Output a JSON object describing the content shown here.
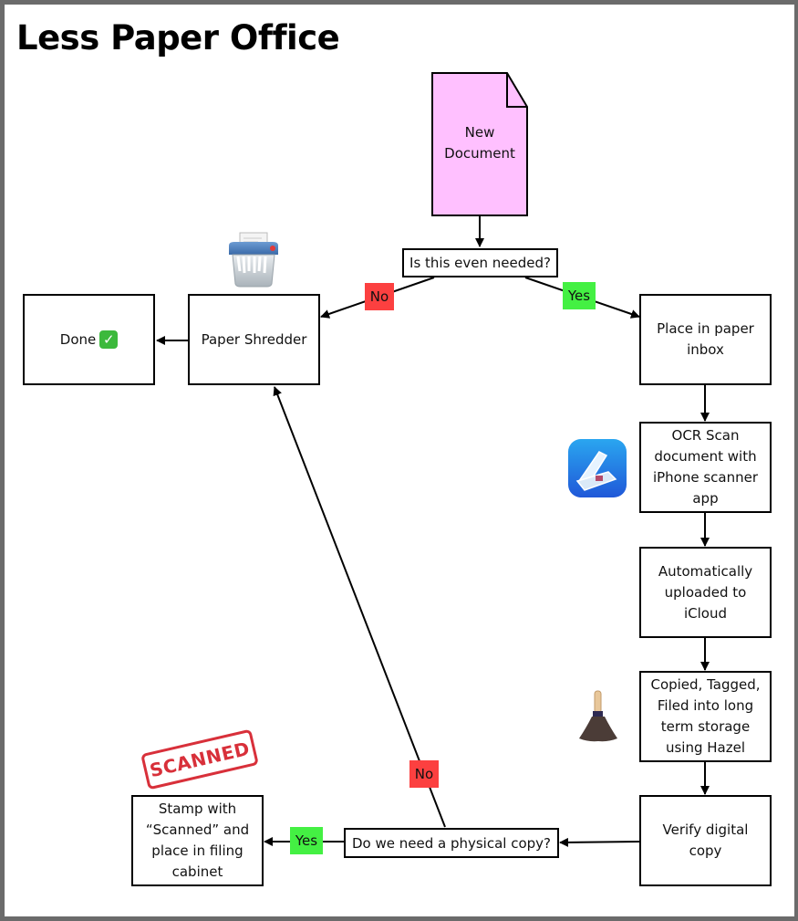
{
  "title": "Less Paper Office",
  "nodes": {
    "new_document": "New\nDocument",
    "decision_needed": "Is this even needed?",
    "paper_shredder": "Paper Shredder",
    "done": "Done",
    "paper_inbox": "Place in paper\ninbox",
    "ocr_scan": "OCR Scan\ndocument with\niPhone scanner\napp",
    "icloud_upload": "Automatically\nuploaded to\niCloud",
    "hazel": "Copied, Tagged,\nFiled into long\nterm storage\nusing Hazel",
    "verify": "Verify digital\ncopy",
    "decision_physical": "Do we need a physical copy?",
    "stamp": "Stamp with\n“Scanned” and\nplace in filing\ncabinet"
  },
  "labels": {
    "no_top": "No",
    "yes_top": "Yes",
    "no_bottom": "No",
    "yes_bottom": "Yes"
  },
  "icons": {
    "done_check": "✓",
    "stamp_text": "SCANNED",
    "shredder": "shredder-icon",
    "scanner": "scanner-app-icon",
    "hazel": "hazel-broom-icon"
  },
  "colors": {
    "document_fill": "#ffc0ff",
    "no_label": "#fc4040",
    "yes_label": "#44f043",
    "stamp_red": "#d8303a",
    "frame": "#6b6b6b"
  }
}
